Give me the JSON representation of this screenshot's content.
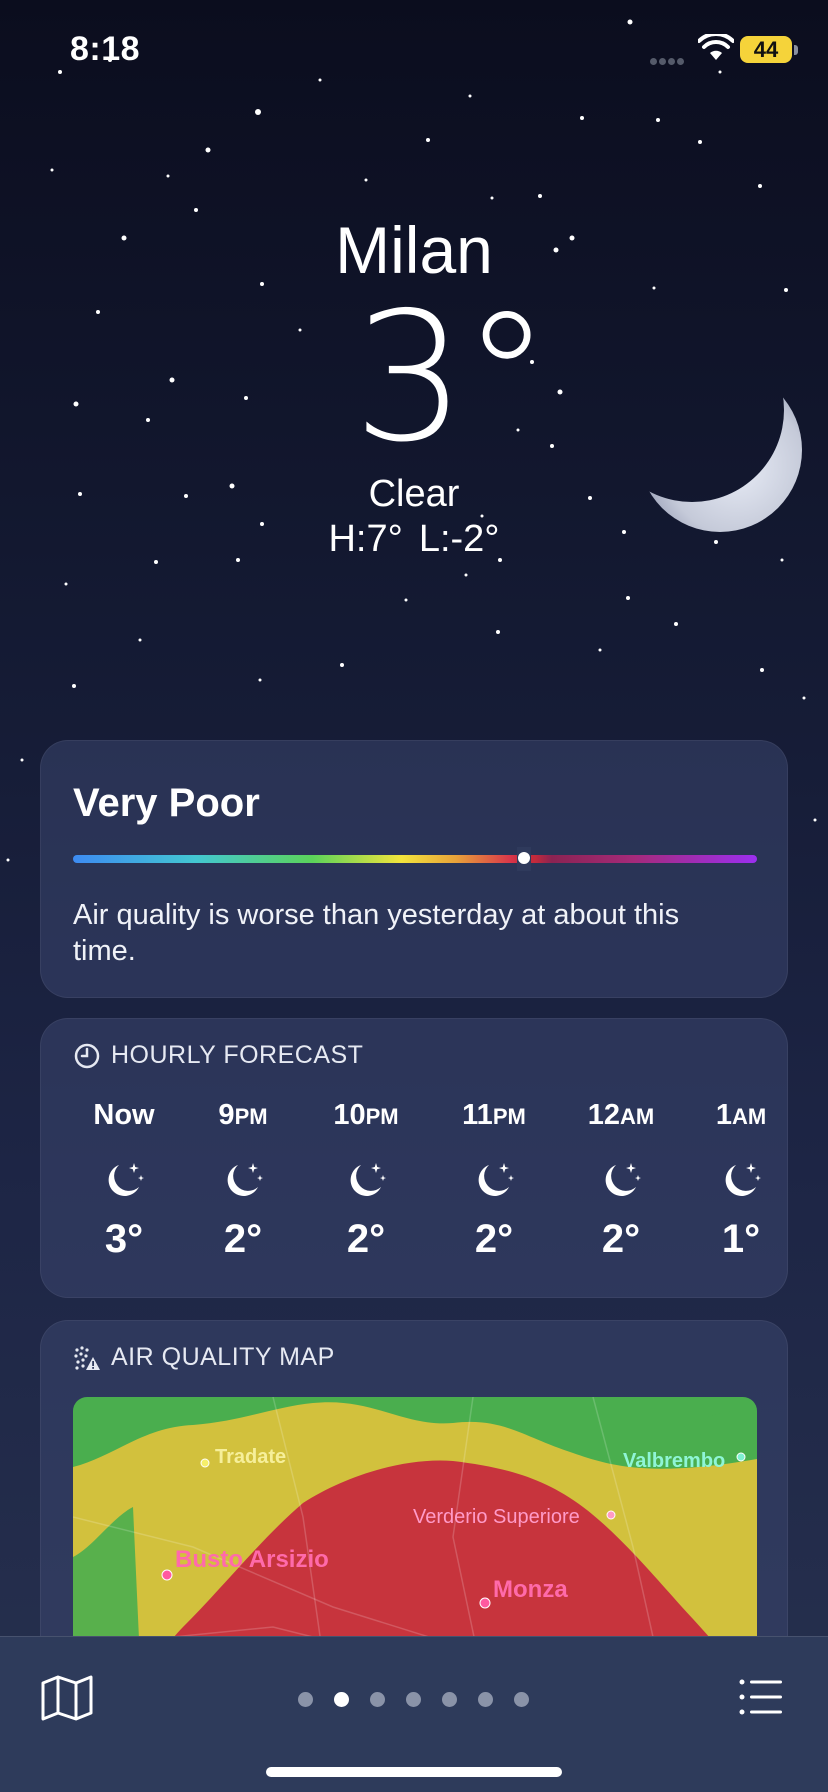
{
  "status_bar": {
    "time": "8:18",
    "battery": "44"
  },
  "hero": {
    "city": "Milan",
    "temperature": "3°",
    "condition": "Clear",
    "high": "H:7°",
    "low": "L:-2°"
  },
  "air_quality": {
    "title": "Very Poor",
    "scale_level": 0.66,
    "description": "Air quality is worse than yesterday at about this time."
  },
  "hourly": {
    "header": "HOURLY FORECAST",
    "items": [
      {
        "label": "Now",
        "suffix": "",
        "icon": "moon-stars-icon",
        "temp": "3°"
      },
      {
        "label": "9",
        "suffix": "PM",
        "icon": "moon-stars-icon",
        "temp": "2°"
      },
      {
        "label": "10",
        "suffix": "PM",
        "icon": "moon-stars-icon",
        "temp": "2°"
      },
      {
        "label": "11",
        "suffix": "PM",
        "icon": "moon-stars-icon",
        "temp": "2°"
      },
      {
        "label": "12",
        "suffix": "AM",
        "icon": "moon-stars-icon",
        "temp": "2°"
      },
      {
        "label": "1",
        "suffix": "AM",
        "icon": "moon-stars-icon",
        "temp": "1°"
      }
    ]
  },
  "air_quality_map": {
    "header": "AIR QUALITY MAP",
    "places": [
      "Tradate",
      "Valbrembo",
      "Verderio Superiore",
      "Busto Arsizio",
      "Monza"
    ]
  },
  "tab_bar": {
    "pages": 7,
    "active_page": 1
  },
  "colors": {
    "good": "#4db14f",
    "moderate": "#d4c33c",
    "very_poor": "#c7343d"
  }
}
